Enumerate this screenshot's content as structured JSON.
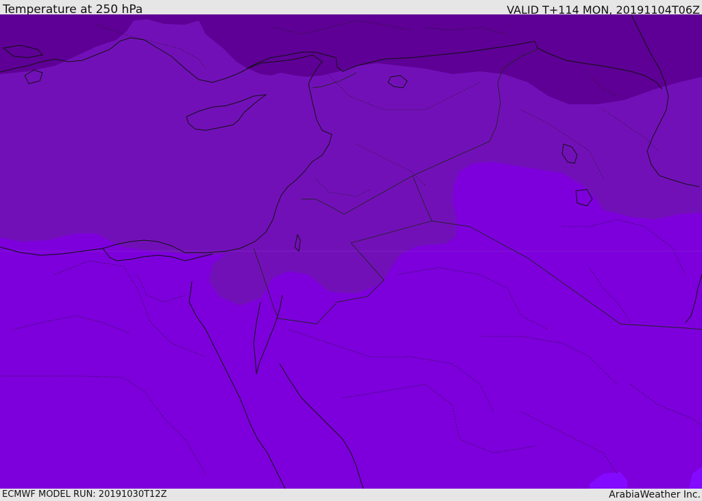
{
  "header": {
    "title": "Temperature at 250 hPa",
    "valid_time": "VALID T+114 MON, 20191104T06Z"
  },
  "footer": {
    "model_run": "ECMWF MODEL RUN: 20191030T12Z",
    "credit": "ArabiaWeather Inc."
  },
  "colors": {
    "band_coldest": "#5e0095",
    "band_cold": "#7210b8",
    "band_mid": "#7d00dc",
    "band_warm": "#8409ff",
    "coastline": "#111111",
    "border": "#222222"
  }
}
